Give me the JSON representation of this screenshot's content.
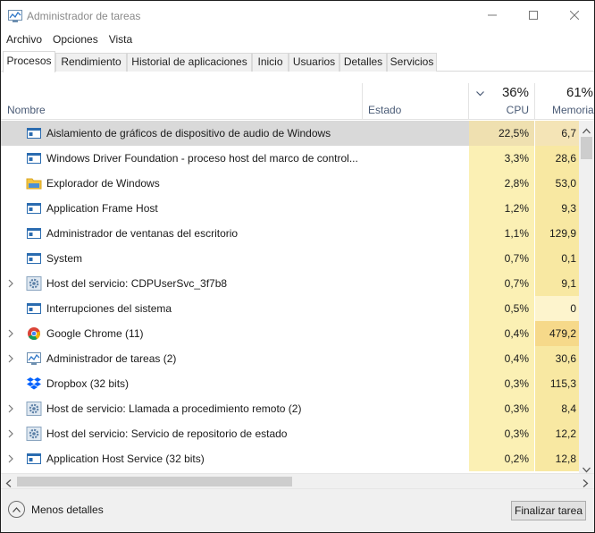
{
  "window": {
    "title": "Administrador de tareas"
  },
  "menu": [
    "Archivo",
    "Opciones",
    "Vista"
  ],
  "tabs": [
    "Procesos",
    "Rendimiento",
    "Historial de aplicaciones",
    "Inicio",
    "Usuarios",
    "Detalles",
    "Servicios"
  ],
  "active_tab": "Procesos",
  "columns": {
    "name": "Nombre",
    "status": "Estado",
    "cpu": {
      "pct": "36%",
      "label": "CPU"
    },
    "memory": {
      "pct": "61%",
      "label": "Memoria"
    }
  },
  "processes": [
    {
      "name": "Aislamiento de gráficos de dispositivo de audio de Windows",
      "cpu": "22,5%",
      "mem": "6,7",
      "icon": "app-window-icon",
      "expandable": false,
      "selected": true
    },
    {
      "name": "Windows Driver Foundation - proceso host del marco de control...",
      "cpu": "3,3%",
      "mem": "28,6",
      "icon": "app-window-icon",
      "expandable": false
    },
    {
      "name": "Explorador de Windows",
      "cpu": "2,8%",
      "mem": "53,0",
      "icon": "folder-icon",
      "expandable": false
    },
    {
      "name": "Application Frame Host",
      "cpu": "1,2%",
      "mem": "9,3",
      "icon": "app-window-icon",
      "expandable": false
    },
    {
      "name": "Administrador de ventanas del escritorio",
      "cpu": "1,1%",
      "mem": "129,9",
      "icon": "app-window-icon",
      "expandable": false
    },
    {
      "name": "System",
      "cpu": "0,7%",
      "mem": "0,1",
      "icon": "app-window-icon",
      "expandable": false
    },
    {
      "name": "Host del servicio: CDPUserSvc_3f7b8",
      "cpu": "0,7%",
      "mem": "9,1",
      "icon": "gear-icon",
      "expandable": true
    },
    {
      "name": "Interrupciones del sistema",
      "cpu": "0,5%",
      "mem": "0",
      "icon": "app-window-icon",
      "expandable": false,
      "mem_light": true
    },
    {
      "name": "Google Chrome (11)",
      "cpu": "0,4%",
      "mem": "479,2",
      "icon": "chrome-icon",
      "expandable": true,
      "mem_dark": true
    },
    {
      "name": "Administrador de tareas (2)",
      "cpu": "0,4%",
      "mem": "30,6",
      "icon": "task-manager-icon",
      "expandable": true
    },
    {
      "name": "Dropbox (32 bits)",
      "cpu": "0,3%",
      "mem": "115,3",
      "icon": "dropbox-icon",
      "expandable": false
    },
    {
      "name": "Host de servicio: Llamada a procedimiento remoto (2)",
      "cpu": "0,3%",
      "mem": "8,4",
      "icon": "gear-icon",
      "expandable": true
    },
    {
      "name": "Host del servicio: Servicio de repositorio de estado",
      "cpu": "0,3%",
      "mem": "12,2",
      "icon": "gear-icon",
      "expandable": true
    },
    {
      "name": "Application Host Service (32 bits)",
      "cpu": "0,2%",
      "mem": "12,8",
      "icon": "app-window-icon",
      "expandable": true
    }
  ],
  "footer": {
    "fewer_details": "Menos detalles",
    "end_task": "Finalizar tarea"
  }
}
